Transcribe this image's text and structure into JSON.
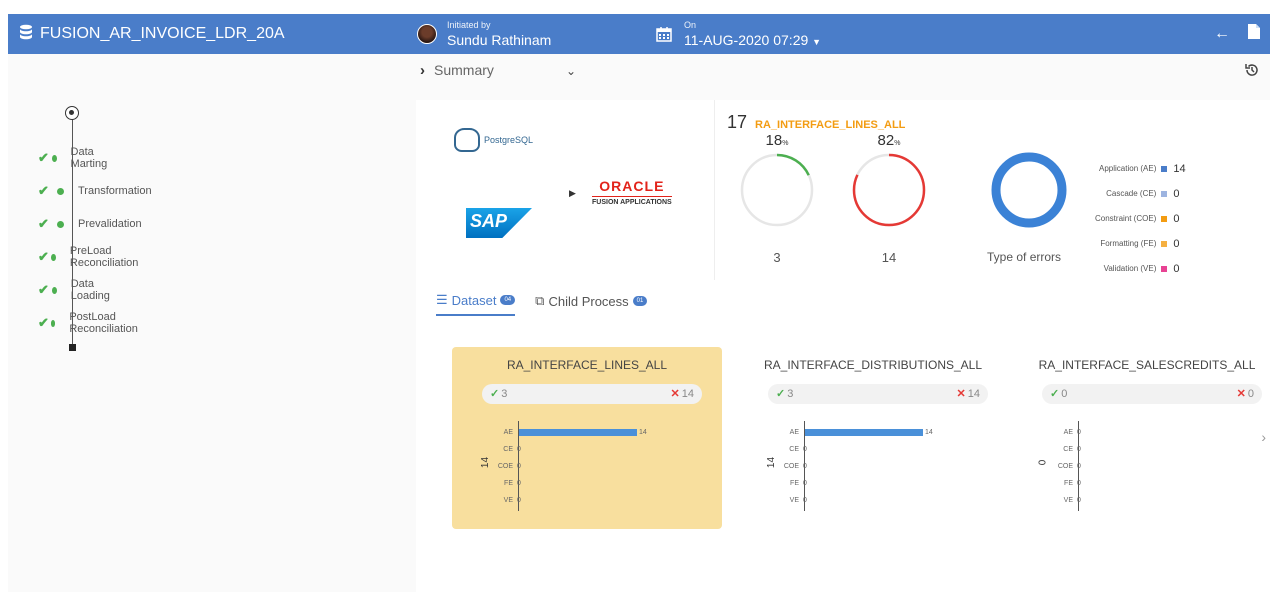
{
  "header": {
    "title": "FUSION_AR_INVOICE_LDR_20A",
    "initiated_label": "Initiated by",
    "initiated_by": "Sundu Rathinam",
    "on_label": "On",
    "on_value": "11-AUG-2020 07:29"
  },
  "sidebar": {
    "steps": [
      {
        "label": "Data Marting"
      },
      {
        "label": "Transformation"
      },
      {
        "label": "Prevalidation"
      },
      {
        "label": "PreLoad Reconciliation"
      },
      {
        "label": "Data Loading"
      },
      {
        "label": "PostLoad Reconciliation"
      }
    ]
  },
  "summary": {
    "label": "Summary",
    "postgres_label": "PostgreSQL",
    "sap_label": "SAP",
    "oracle_label": "ORACLE",
    "oracle_sub": "FUSION APPLICATIONS"
  },
  "stats": {
    "count": "17",
    "table": "RA_INTERFACE_LINES_ALL",
    "success_pct": "18",
    "error_pct": "82",
    "pct_unit": "%",
    "success_count": "3",
    "error_count": "14",
    "type_of_errors_label": "Type of errors",
    "legend": [
      {
        "label": "Application (AE)",
        "value": "14",
        "color": "#4a7dc9"
      },
      {
        "label": "Cascade (CE)",
        "value": "0",
        "color": "#9db4e0"
      },
      {
        "label": "Constraint (COE)",
        "value": "0",
        "color": "#f39c12"
      },
      {
        "label": "Formatting (FE)",
        "value": "0",
        "color": "#f5b041"
      },
      {
        "label": "Validation (VE)",
        "value": "0",
        "color": "#e84393"
      }
    ]
  },
  "tabs": [
    {
      "label": "Dataset",
      "count": "04"
    },
    {
      "label": "Child Process",
      "count": "01"
    }
  ],
  "cards": [
    {
      "title": "RA_INTERFACE_LINES_ALL",
      "ok": "3",
      "err": "14",
      "total": "14",
      "rows": [
        {
          "cat": "AE",
          "value": 14
        },
        {
          "cat": "CE",
          "value": 0
        },
        {
          "cat": "COE",
          "value": 0
        },
        {
          "cat": "FE",
          "value": 0
        },
        {
          "cat": "VE",
          "value": 0
        }
      ]
    },
    {
      "title": "RA_INTERFACE_DISTRIBUTIONS_ALL",
      "ok": "3",
      "err": "14",
      "total": "14",
      "rows": [
        {
          "cat": "AE",
          "value": 14
        },
        {
          "cat": "CE",
          "value": 0
        },
        {
          "cat": "COE",
          "value": 0
        },
        {
          "cat": "FE",
          "value": 0
        },
        {
          "cat": "VE",
          "value": 0
        }
      ]
    },
    {
      "title": "RA_INTERFACE_SALESCREDITS_ALL",
      "ok": "0",
      "err": "0",
      "total": "0",
      "rows": [
        {
          "cat": "AE",
          "value": 0
        },
        {
          "cat": "CE",
          "value": 0
        },
        {
          "cat": "COE",
          "value": 0
        },
        {
          "cat": "FE",
          "value": 0
        },
        {
          "cat": "VE",
          "value": 0
        }
      ]
    }
  ],
  "colors": {
    "header": "#4a7dc9",
    "success": "#4caf50",
    "error": "#e53935",
    "highlight": "#f8df9e"
  }
}
